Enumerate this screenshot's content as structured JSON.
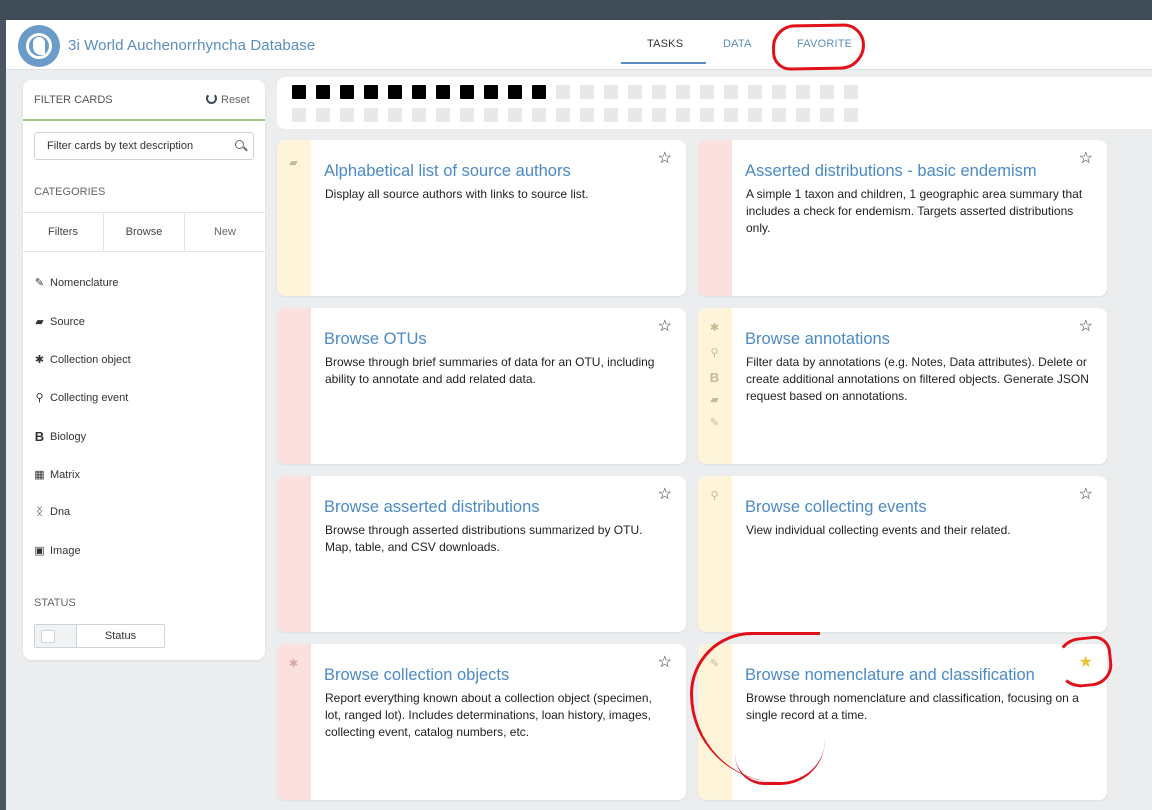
{
  "app": {
    "title": "3i World Auchenorrhyncha Database",
    "accent_color": "#5a8dbd",
    "logo_icon": "lizard-logo-icon"
  },
  "nav": {
    "tasks": "TASKS",
    "data": "DATA",
    "favorite": "FAVORITE",
    "active": "TASKS"
  },
  "filter_panel": {
    "title": "FILTER CARDS",
    "reset_label": "Reset",
    "search_placeholder": "Filter cards by text description",
    "categories_heading": "CATEGORIES",
    "tabs": [
      "Filters",
      "Browse",
      "New"
    ],
    "categories": [
      {
        "label": "Nomenclature",
        "icon": "edit-icon"
      },
      {
        "label": "Source",
        "icon": "book-icon"
      },
      {
        "label": "Collection object",
        "icon": "bug-icon"
      },
      {
        "label": "Collecting event",
        "icon": "map-pin-icon"
      },
      {
        "label": "Biology",
        "icon": "bold-b-icon"
      },
      {
        "label": "Matrix",
        "icon": "table-icon"
      },
      {
        "label": "Dna",
        "icon": "dna-icon"
      },
      {
        "label": "Image",
        "icon": "image-icon"
      }
    ],
    "status_heading": "STATUS",
    "status_toggle_label": "Status"
  },
  "pager": {
    "total_pages": 48,
    "current_filled": 11
  },
  "cards": [
    {
      "title": "Alphabetical list of source authors",
      "description": "Display all source authors with links to source list.",
      "color": "yellow",
      "icons": [
        "book-icon"
      ],
      "favorite": false
    },
    {
      "title": "Asserted distributions - basic endemism",
      "description": "A simple 1 taxon and children, 1 geographic area summary that includes a check for endemism. Targets asserted distributions only.",
      "color": "red",
      "icons": [],
      "favorite": false
    },
    {
      "title": "Browse OTUs",
      "description": "Browse through brief summaries of data for an OTU, including ability to annotate and add related data.",
      "color": "red",
      "icons": [],
      "favorite": false
    },
    {
      "title": "Browse annotations",
      "description": "Filter data by annotations (e.g. Notes, Data attributes). Delete or create additional annotations on filtered objects. Generate JSON request based on annotations.",
      "color": "yellow",
      "icons": [
        "bug-icon",
        "map-pin-icon",
        "bold-b-icon",
        "book-icon",
        "edit-icon"
      ],
      "favorite": false
    },
    {
      "title": "Browse asserted distributions",
      "description": "Browse through asserted distributions summarized by OTU. Map, table, and CSV downloads.",
      "color": "red",
      "icons": [],
      "favorite": false
    },
    {
      "title": "Browse collecting events",
      "description": "View individual collecting events and their related.",
      "color": "yellow",
      "icons": [
        "map-pin-icon"
      ],
      "favorite": false
    },
    {
      "title": "Browse collection objects",
      "description": "Report everything known about a collection object (specimen, lot, ranged lot). Includes determinations, loan history, images, collecting event, catalog numbers, etc.",
      "color": "red",
      "icons": [
        "bug-icon"
      ],
      "favorite": false
    },
    {
      "title": "Browse nomenclature and classification",
      "description": "Browse through nomenclature and classification, focusing on a single record at a time.",
      "color": "yellow",
      "icons": [
        "edit-icon"
      ],
      "favorite": true
    }
  ],
  "colors": {
    "card_side_yellow": "#fdf4da",
    "card_side_red": "#fce0df",
    "favorite_star": "#e8c436",
    "annotation_red": "#e0111a"
  }
}
